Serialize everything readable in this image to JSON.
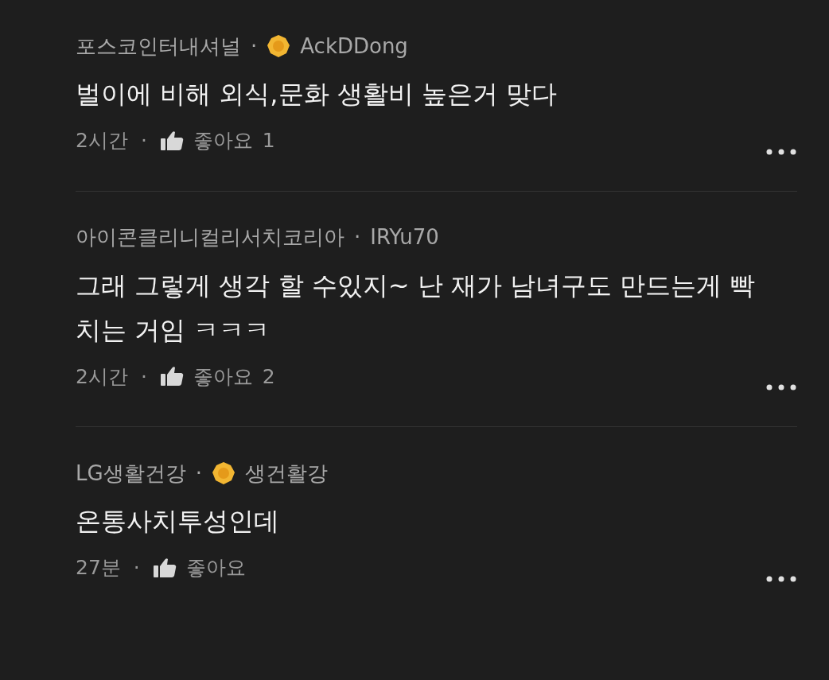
{
  "comments": [
    {
      "company": "포스코인터내셔널",
      "separator": "·",
      "badge": true,
      "nickname": "AckDDong",
      "text": "벌이에 비해 외식,문화 생활비 높은거 맞다",
      "time": "2시간",
      "meta_separator": "·",
      "like_label": "좋아요",
      "like_count": "1"
    },
    {
      "company": "아이콘클리니컬리서치코리아",
      "separator": "·",
      "badge": false,
      "nickname": "IRYu70",
      "text": "그래 그렇게 생각 할 수있지~ 난 재가 남녀구도 만드는게 빡치는 거임 ㅋㅋㅋ",
      "time": "2시간",
      "meta_separator": "·",
      "like_label": "좋아요",
      "like_count": "2"
    },
    {
      "company": "LG생활건강",
      "separator": "·",
      "badge": true,
      "nickname": "생건활강",
      "text": "온통사치투성인데",
      "time": "27분",
      "meta_separator": "·",
      "like_label": "좋아요"
    }
  ]
}
